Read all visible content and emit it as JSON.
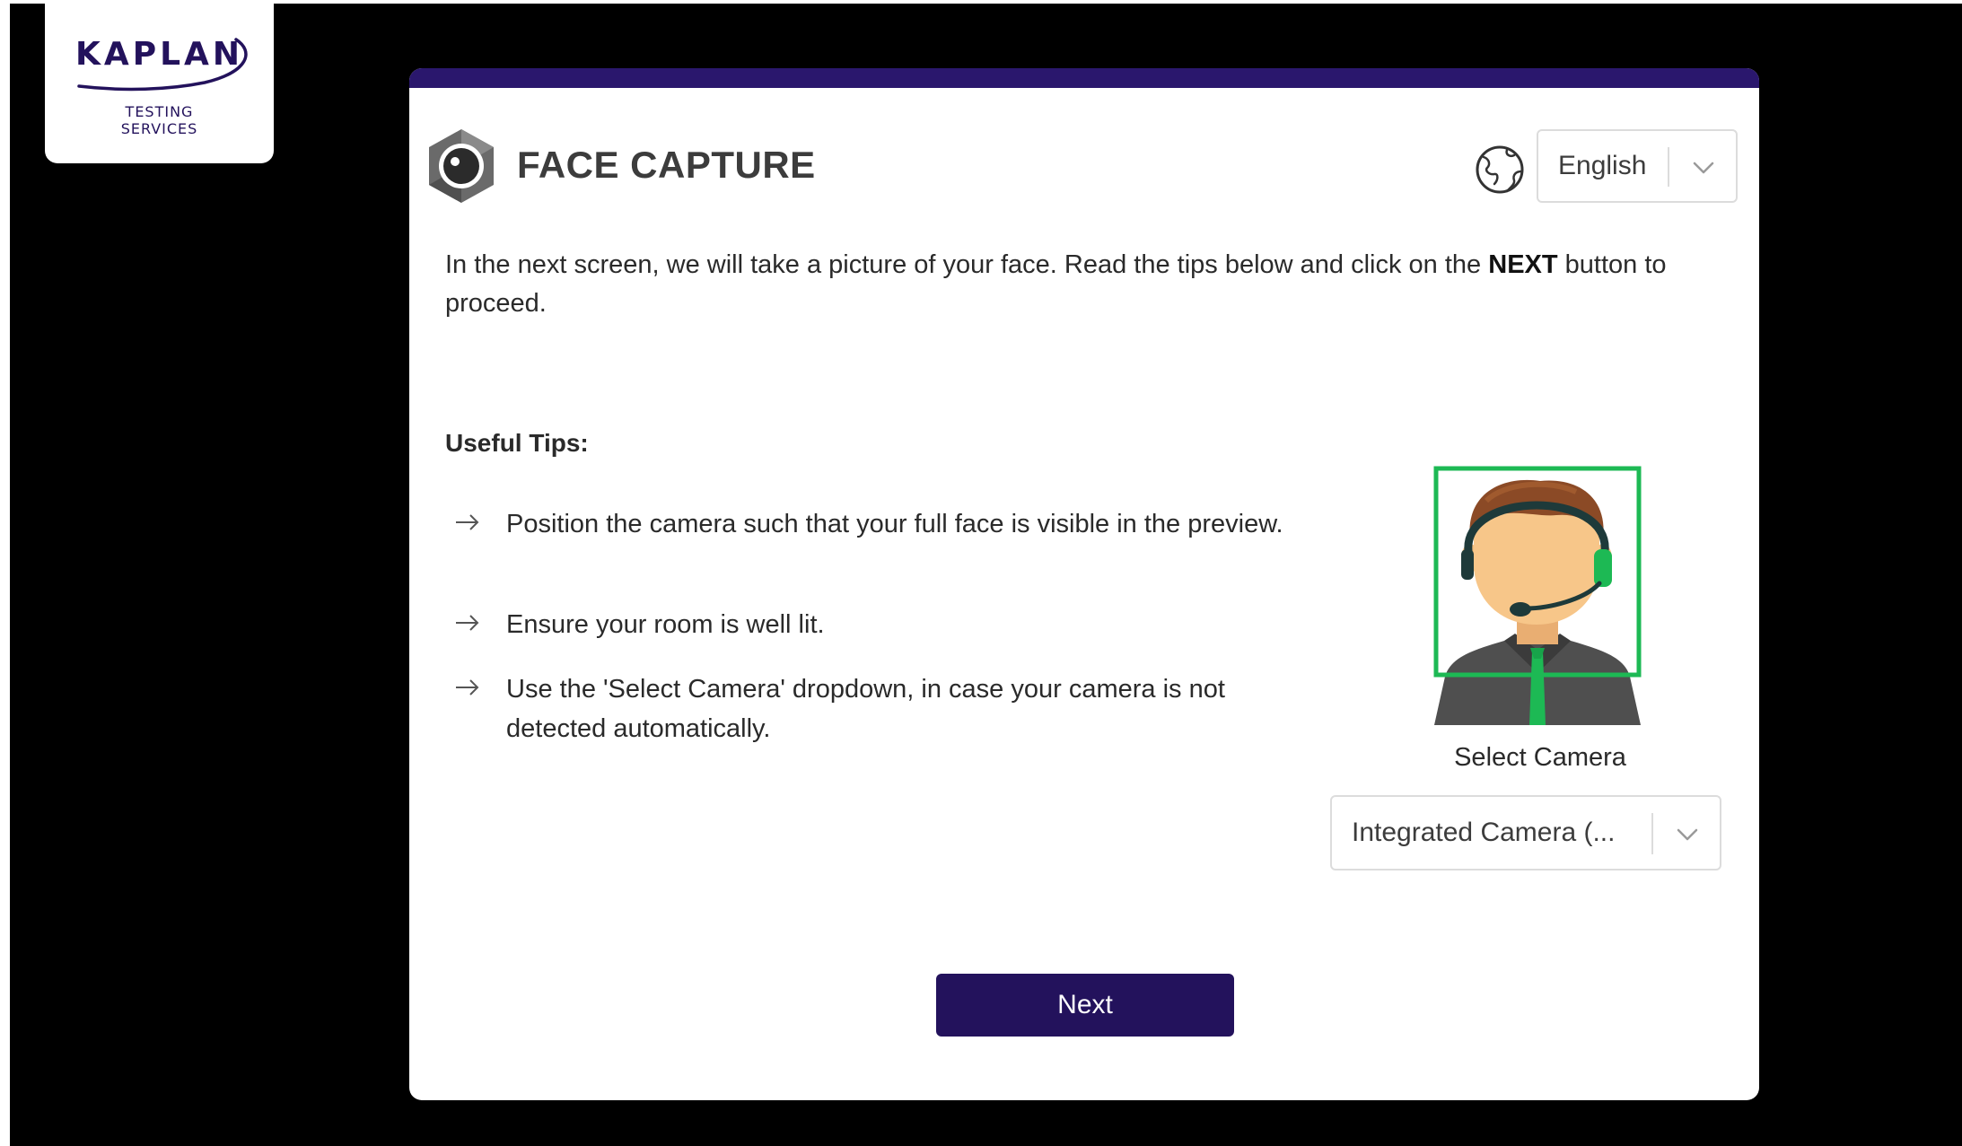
{
  "logo": {
    "brand": "KAPLAN",
    "sub_line1": "TESTING",
    "sub_line2": "SERVICES"
  },
  "header": {
    "title": "FACE CAPTURE",
    "language": {
      "selected": "English"
    }
  },
  "intro": {
    "before": "In the next screen, we will take a picture of your face. Read the tips below and click on the ",
    "emphasis": "NEXT",
    "after": " button to proceed."
  },
  "tips": {
    "heading": "Useful Tips:",
    "items": [
      "Position the camera such that your full face is visible in the preview.",
      "Ensure your room is well lit.",
      "Use the 'Select Camera' dropdown, in case your camera is not detected automatically."
    ]
  },
  "camera": {
    "label": "Select Camera",
    "selected": "Integrated Camera (..."
  },
  "actions": {
    "next_label": "Next"
  },
  "icons": {
    "title_icon": "camera-lens-hex-icon",
    "language_icon": "globe-icon",
    "tip_bullet": "arrow-right-icon",
    "dropdown": "chevron-down-icon",
    "illustration": "agent-headset-avatar"
  },
  "colors": {
    "brand_purple": "#23125c",
    "topbar_purple": "#2a176d",
    "face_frame_green": "#1db954",
    "background": "#000000",
    "card": "#ffffff"
  }
}
